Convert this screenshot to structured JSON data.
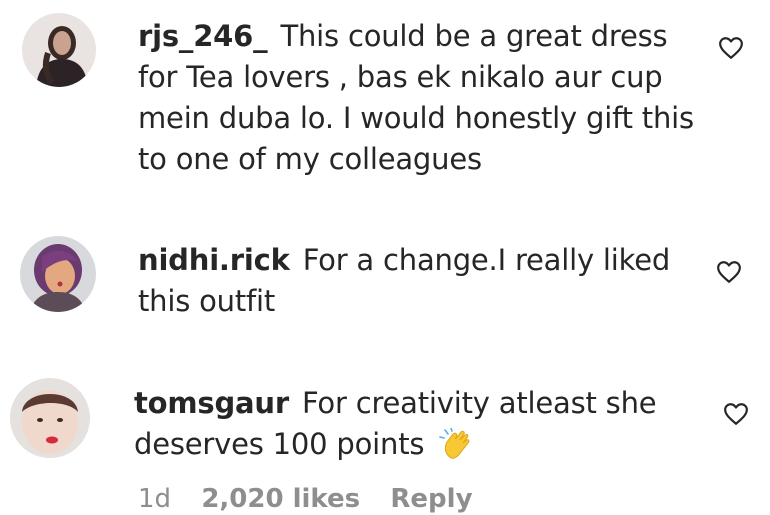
{
  "comments": [
    {
      "username": "rjs_246_",
      "text": "This could be a great dress for Tea lovers , bas ek nikalo aur cup mein duba lo. I would honestly gift this to one of my colleagues"
    },
    {
      "username": "nidhi.rick",
      "text": "For a change.I really liked this outfit"
    },
    {
      "username": "tomsgaur",
      "text": "For creativity atleast she deserves 100 points",
      "emoji": "clapping-hands"
    }
  ],
  "footer": {
    "time": "1d",
    "likes": "2,020 likes",
    "reply": "Reply"
  },
  "colors": {
    "text": "#262626",
    "meta": "#8e8e8e"
  }
}
